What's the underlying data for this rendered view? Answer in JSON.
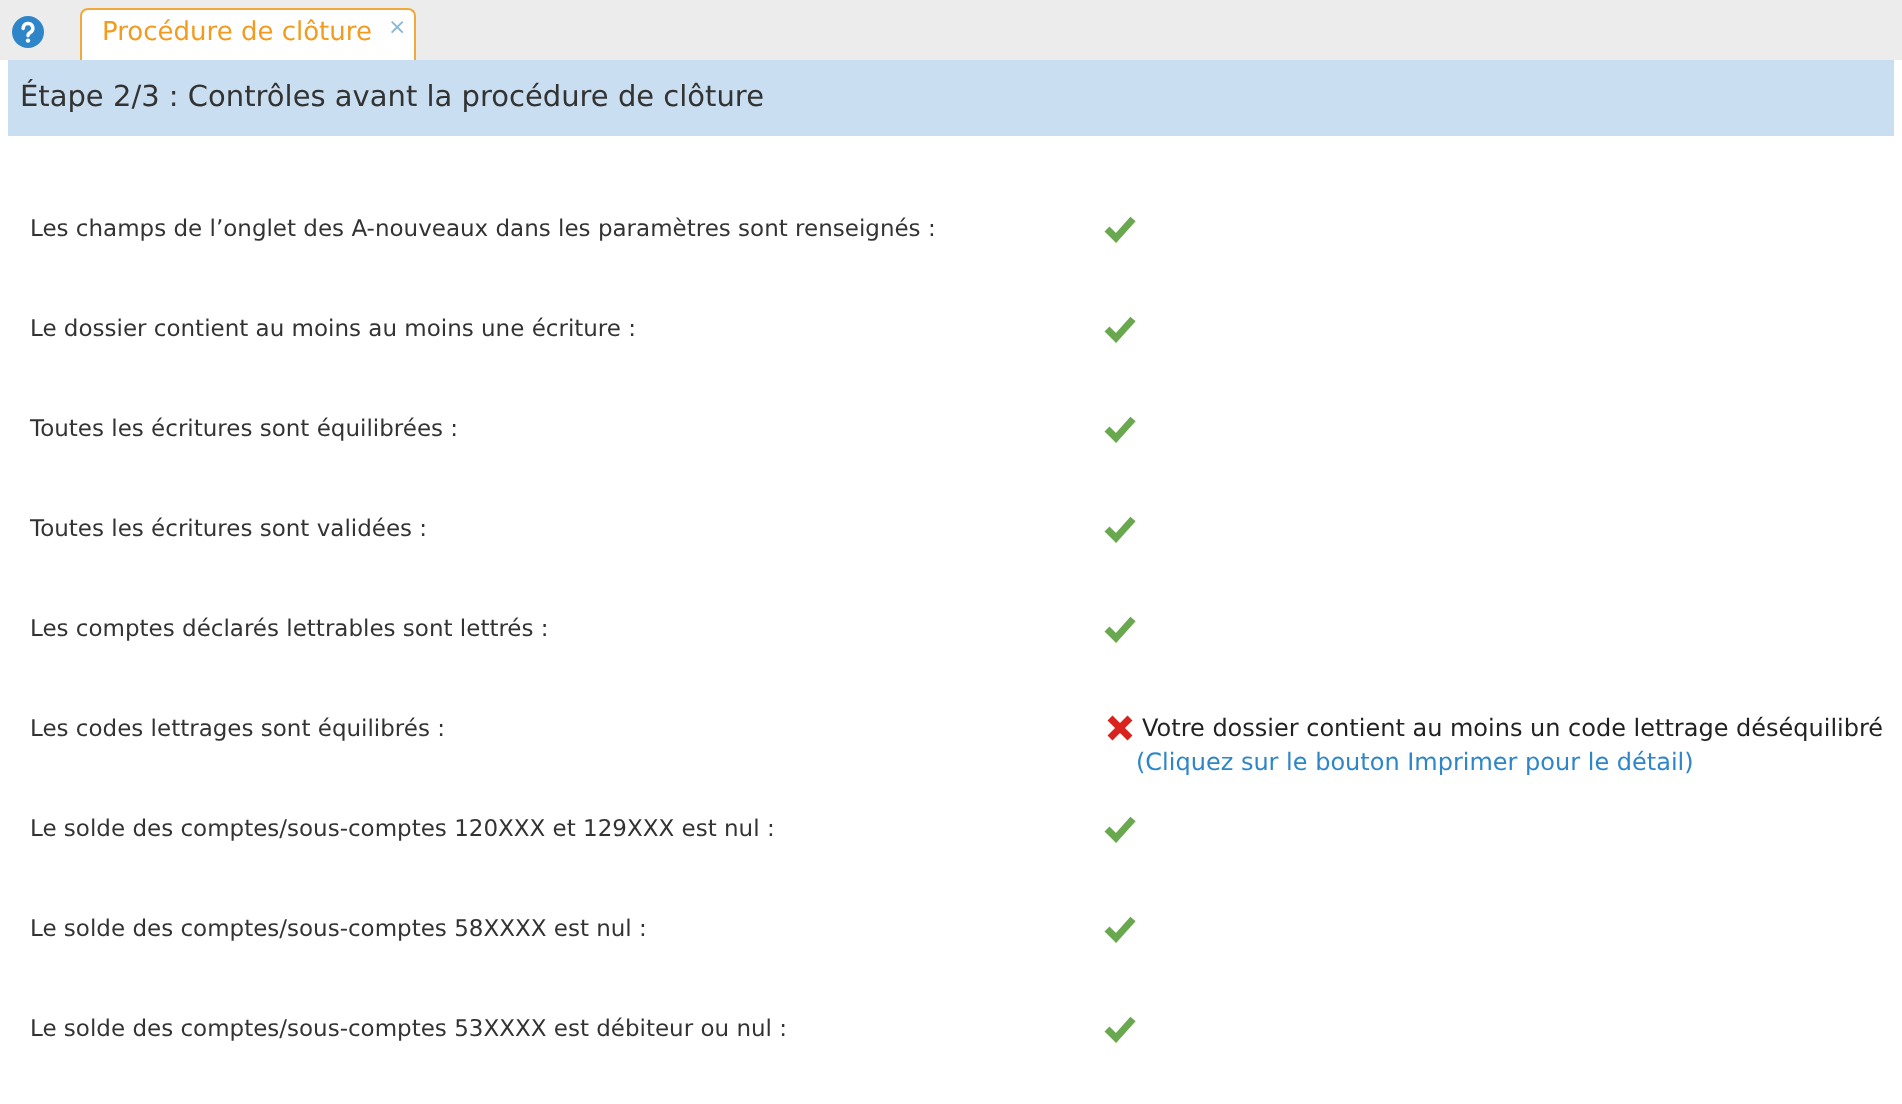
{
  "tabs": [
    {
      "label": "Procédure de clôture",
      "selected": true,
      "close": "×"
    }
  ],
  "step_header": {
    "title": "Étape 2/3 : Contrôles avant la procédure de clôture"
  },
  "checks": [
    {
      "label": "Les champs de l’onglet des A-nouveaux dans les paramètres sont renseignés :",
      "passed": true
    },
    {
      "label": "Le dossier contient au moins au moins une écriture :",
      "passed": true
    },
    {
      "label": "Toutes les écritures sont équilibrées :",
      "passed": true
    },
    {
      "label": "Toutes les écritures sont validées :",
      "passed": true
    },
    {
      "label": "Les comptes déclarés lettrables sont lettrés :",
      "passed": true
    },
    {
      "label": "Les codes lettrages sont équilibrés :",
      "passed": false,
      "message": "Votre dossier contient au moins un code lettrage déséquilibré",
      "detail_link": "(Cliquez sur le bouton Imprimer pour le détail)"
    },
    {
      "label": "Le solde des comptes/sous-comptes 120XXX et 129XXX est nul :",
      "passed": true
    },
    {
      "label": "Le solde des comptes/sous-comptes 58XXXX est nul :",
      "passed": true
    },
    {
      "label": "Le solde des comptes/sous-comptes 53XXXX est débiteur ou nul :",
      "passed": true
    }
  ]
}
